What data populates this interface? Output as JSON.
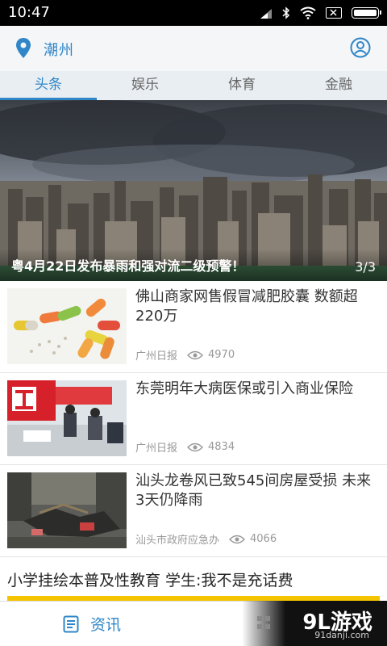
{
  "status_bar": {
    "time": "10:47"
  },
  "top_bar": {
    "city": "潮州"
  },
  "tabs": [
    {
      "label": "头条",
      "active": true
    },
    {
      "label": "娱乐",
      "active": false
    },
    {
      "label": "体育",
      "active": false
    },
    {
      "label": "金融",
      "active": false
    }
  ],
  "banner": {
    "caption": "粤4月22日发布暴雨和强对流二级预警！",
    "counter": "3/3"
  },
  "news": [
    {
      "title": "佛山商家网售假冒减肥胶囊 数额超220万",
      "source": "广州日报",
      "views": "4970"
    },
    {
      "title": "东莞明年大病医保或引入商业保险",
      "source": "广州日报",
      "views": "4834"
    },
    {
      "title": "汕头龙卷风已致545间房屋受损 未来3天仍降雨",
      "source": "汕头市政府应急办",
      "views": "4066"
    }
  ],
  "headline": {
    "title": "小学挂绘本普及性教育 学生:我不是充话费"
  },
  "bottom_nav": {
    "news_label": "资讯"
  },
  "watermark": {
    "logo": "9L游戏",
    "site": "91danji.com"
  },
  "colors": {
    "accent": "#2f86c8",
    "highlight": "#f5c400"
  }
}
